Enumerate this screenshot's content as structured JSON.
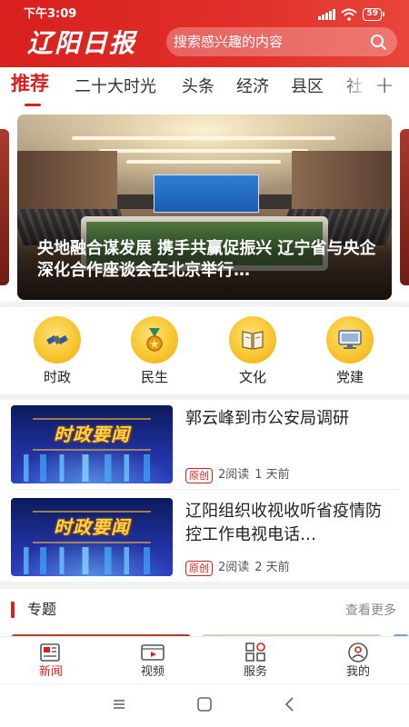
{
  "status_bar": {
    "time": "下午3:09",
    "battery": "59"
  },
  "header": {
    "logo": "辽阳日报",
    "search": {
      "placeholder": "搜索感兴趣的内容"
    }
  },
  "tabs": {
    "items": [
      {
        "label": "推荐",
        "active": true
      },
      {
        "label": "二十大时光"
      },
      {
        "label": "头条"
      },
      {
        "label": "经济"
      },
      {
        "label": "县区"
      },
      {
        "label": "社"
      }
    ],
    "add_label": "+"
  },
  "carousel": {
    "title": "央地融合谋发展 携手共赢促振兴 辽宁省与央企深化合作座谈会在北京举行…"
  },
  "channels": [
    {
      "label": "时政",
      "icon": "satellite-icon"
    },
    {
      "label": "民生",
      "icon": "medal-icon"
    },
    {
      "label": "文化",
      "icon": "book-icon"
    },
    {
      "label": "党建",
      "icon": "computer-icon"
    }
  ],
  "news": [
    {
      "title": "郭云峰到市公安局调研",
      "thumb_text": "时政要闻",
      "badge": "原创",
      "reads": "2阅读",
      "time": "1 天前"
    },
    {
      "title": "辽阳组织收视收听省疫情防控工作电视电话…",
      "thumb_text": "时政要闻",
      "badge": "原创",
      "reads": "2阅读",
      "time": "2 天前"
    }
  ],
  "topics": {
    "title": "专题",
    "more": "查看更多"
  },
  "bottom_nav": [
    {
      "label": "新闻",
      "icon": "newspaper-icon",
      "active": true
    },
    {
      "label": "视频",
      "icon": "video-icon"
    },
    {
      "label": "服务",
      "icon": "grid-icon"
    },
    {
      "label": "我的",
      "icon": "user-icon"
    }
  ],
  "colors": {
    "brand": "#d8201e",
    "accent_gold": "#f8c630",
    "thumb_blue": "#1f2f9a"
  }
}
